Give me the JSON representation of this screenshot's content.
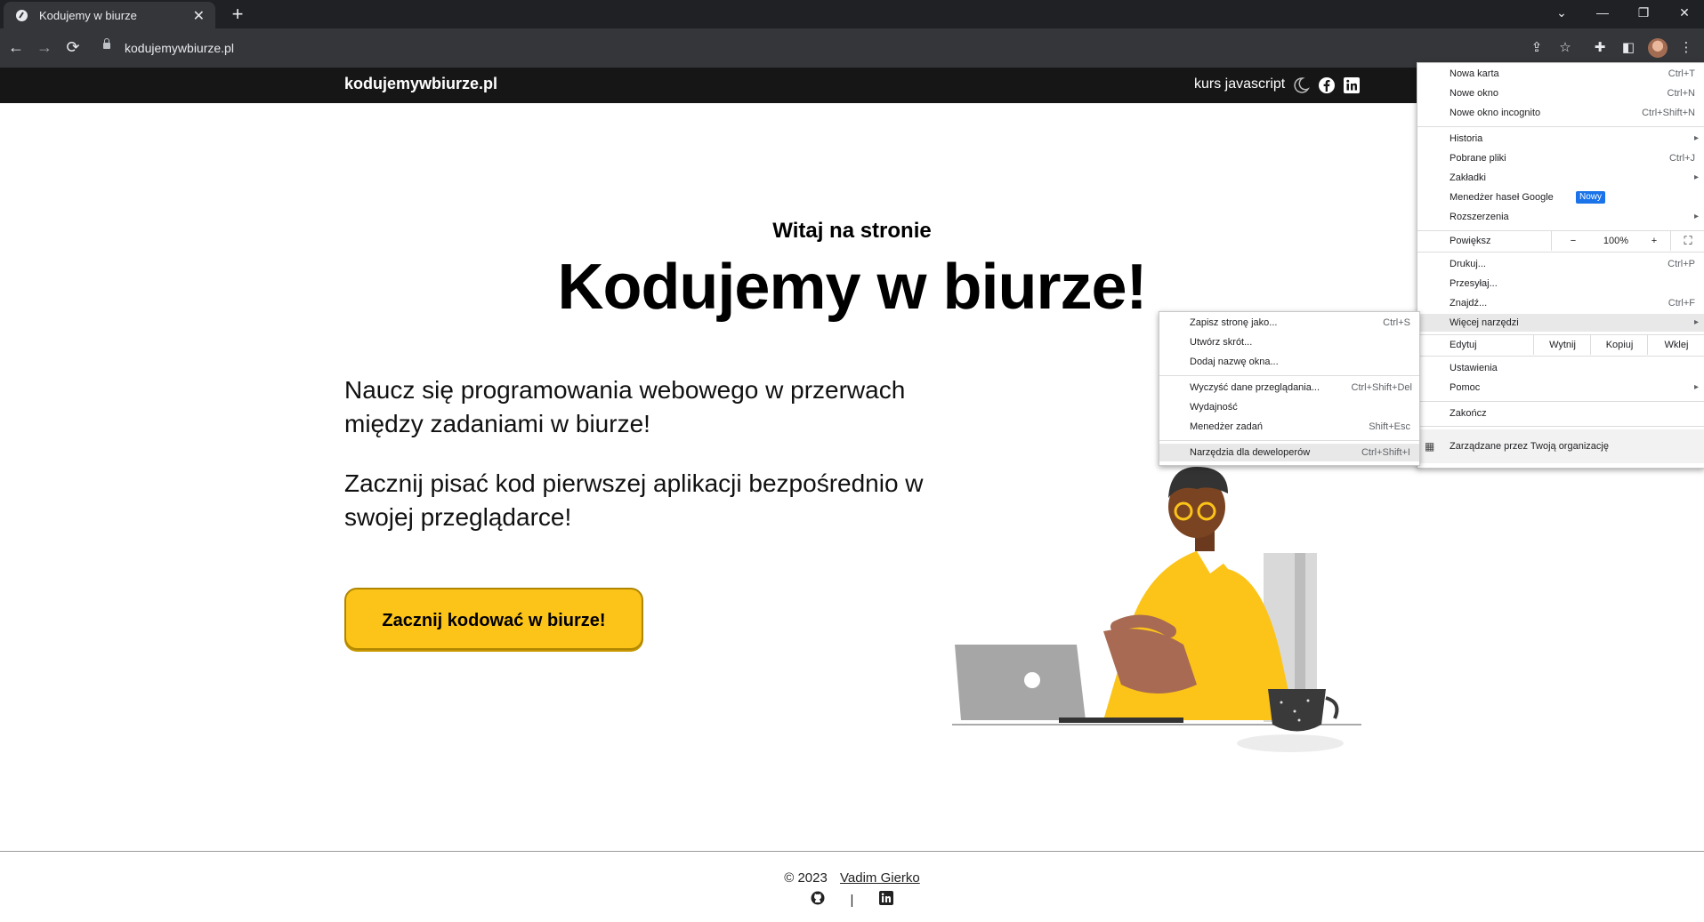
{
  "browser": {
    "tab_title": "Kodujemy w biurze",
    "close_glyph": "✕",
    "newtab_glyph": "+",
    "url": "kodujemywbiurze.pl",
    "window_buttons": [
      "⌄",
      "—",
      "❐",
      "✕"
    ],
    "nav_glyphs": {
      "back": "←",
      "forward": "→",
      "reload": "⟳"
    }
  },
  "site": {
    "brand": "kodujemywbiurze.pl",
    "nav_link": "kurs javascript",
    "kicker": "Witaj na stronie",
    "hero": "Kodujemy w biurze!",
    "para1": "Naucz się programowania webowego w przerwach między zadaniami w biurze!",
    "para2": "Zacznij pisać kod pierwszej aplikacji bezpośrednio w swojej przeglądarce!",
    "cta": "Zacznij kodować w biurze!",
    "footer_copy": "© 2023",
    "footer_author": "Vadim Gierko",
    "footer_sep": "|"
  },
  "chrome_menu": {
    "items": [
      {
        "label": "Nowa karta",
        "shortcut": "Ctrl+T"
      },
      {
        "label": "Nowe okno",
        "shortcut": "Ctrl+N"
      },
      {
        "label": "Nowe okno incognito",
        "shortcut": "Ctrl+Shift+N"
      },
      {
        "label": "Historia",
        "arrow": "▸"
      },
      {
        "label": "Pobrane pliki",
        "shortcut": "Ctrl+J"
      },
      {
        "label": "Zakładki",
        "arrow": "▸"
      },
      {
        "label": "Menedżer haseł Google",
        "badge": "Nowy"
      },
      {
        "label": "Rozszerzenia",
        "arrow": "▸"
      },
      {
        "label": "Powiększ",
        "zoom_minus": "−",
        "zoom_value": "100%",
        "zoom_plus": "+"
      },
      {
        "label": "Drukuj...",
        "shortcut": "Ctrl+P"
      },
      {
        "label": "Przesyłaj..."
      },
      {
        "label": "Znajdź...",
        "shortcut": "Ctrl+F"
      },
      {
        "label": "Więcej narzędzi",
        "arrow": "▸"
      },
      {
        "label": "Edytuj",
        "cut": "Wytnij",
        "copy": "Kopiuj",
        "paste": "Wklej"
      },
      {
        "label": "Ustawienia"
      },
      {
        "label": "Pomoc",
        "arrow": "▸"
      },
      {
        "label": "Zakończ"
      },
      {
        "label": "Zarządzane przez Twoją organizację"
      }
    ]
  },
  "submenu": {
    "items": [
      {
        "label": "Zapisz stronę jako...",
        "shortcut": "Ctrl+S"
      },
      {
        "label": "Utwórz skrót..."
      },
      {
        "label": "Dodaj nazwę okna..."
      },
      {
        "label": "Wyczyść dane przeglądania...",
        "shortcut": "Ctrl+Shift+Del"
      },
      {
        "label": "Wydajność"
      },
      {
        "label": "Menedżer zadań",
        "shortcut": "Shift+Esc"
      },
      {
        "label": "Narzędzia dla deweloperów",
        "shortcut": "Ctrl+Shift+I"
      }
    ]
  },
  "colors": {
    "accent": "#fcc419",
    "highlight": "#e8e8e8",
    "badge": "#1a73e8"
  }
}
